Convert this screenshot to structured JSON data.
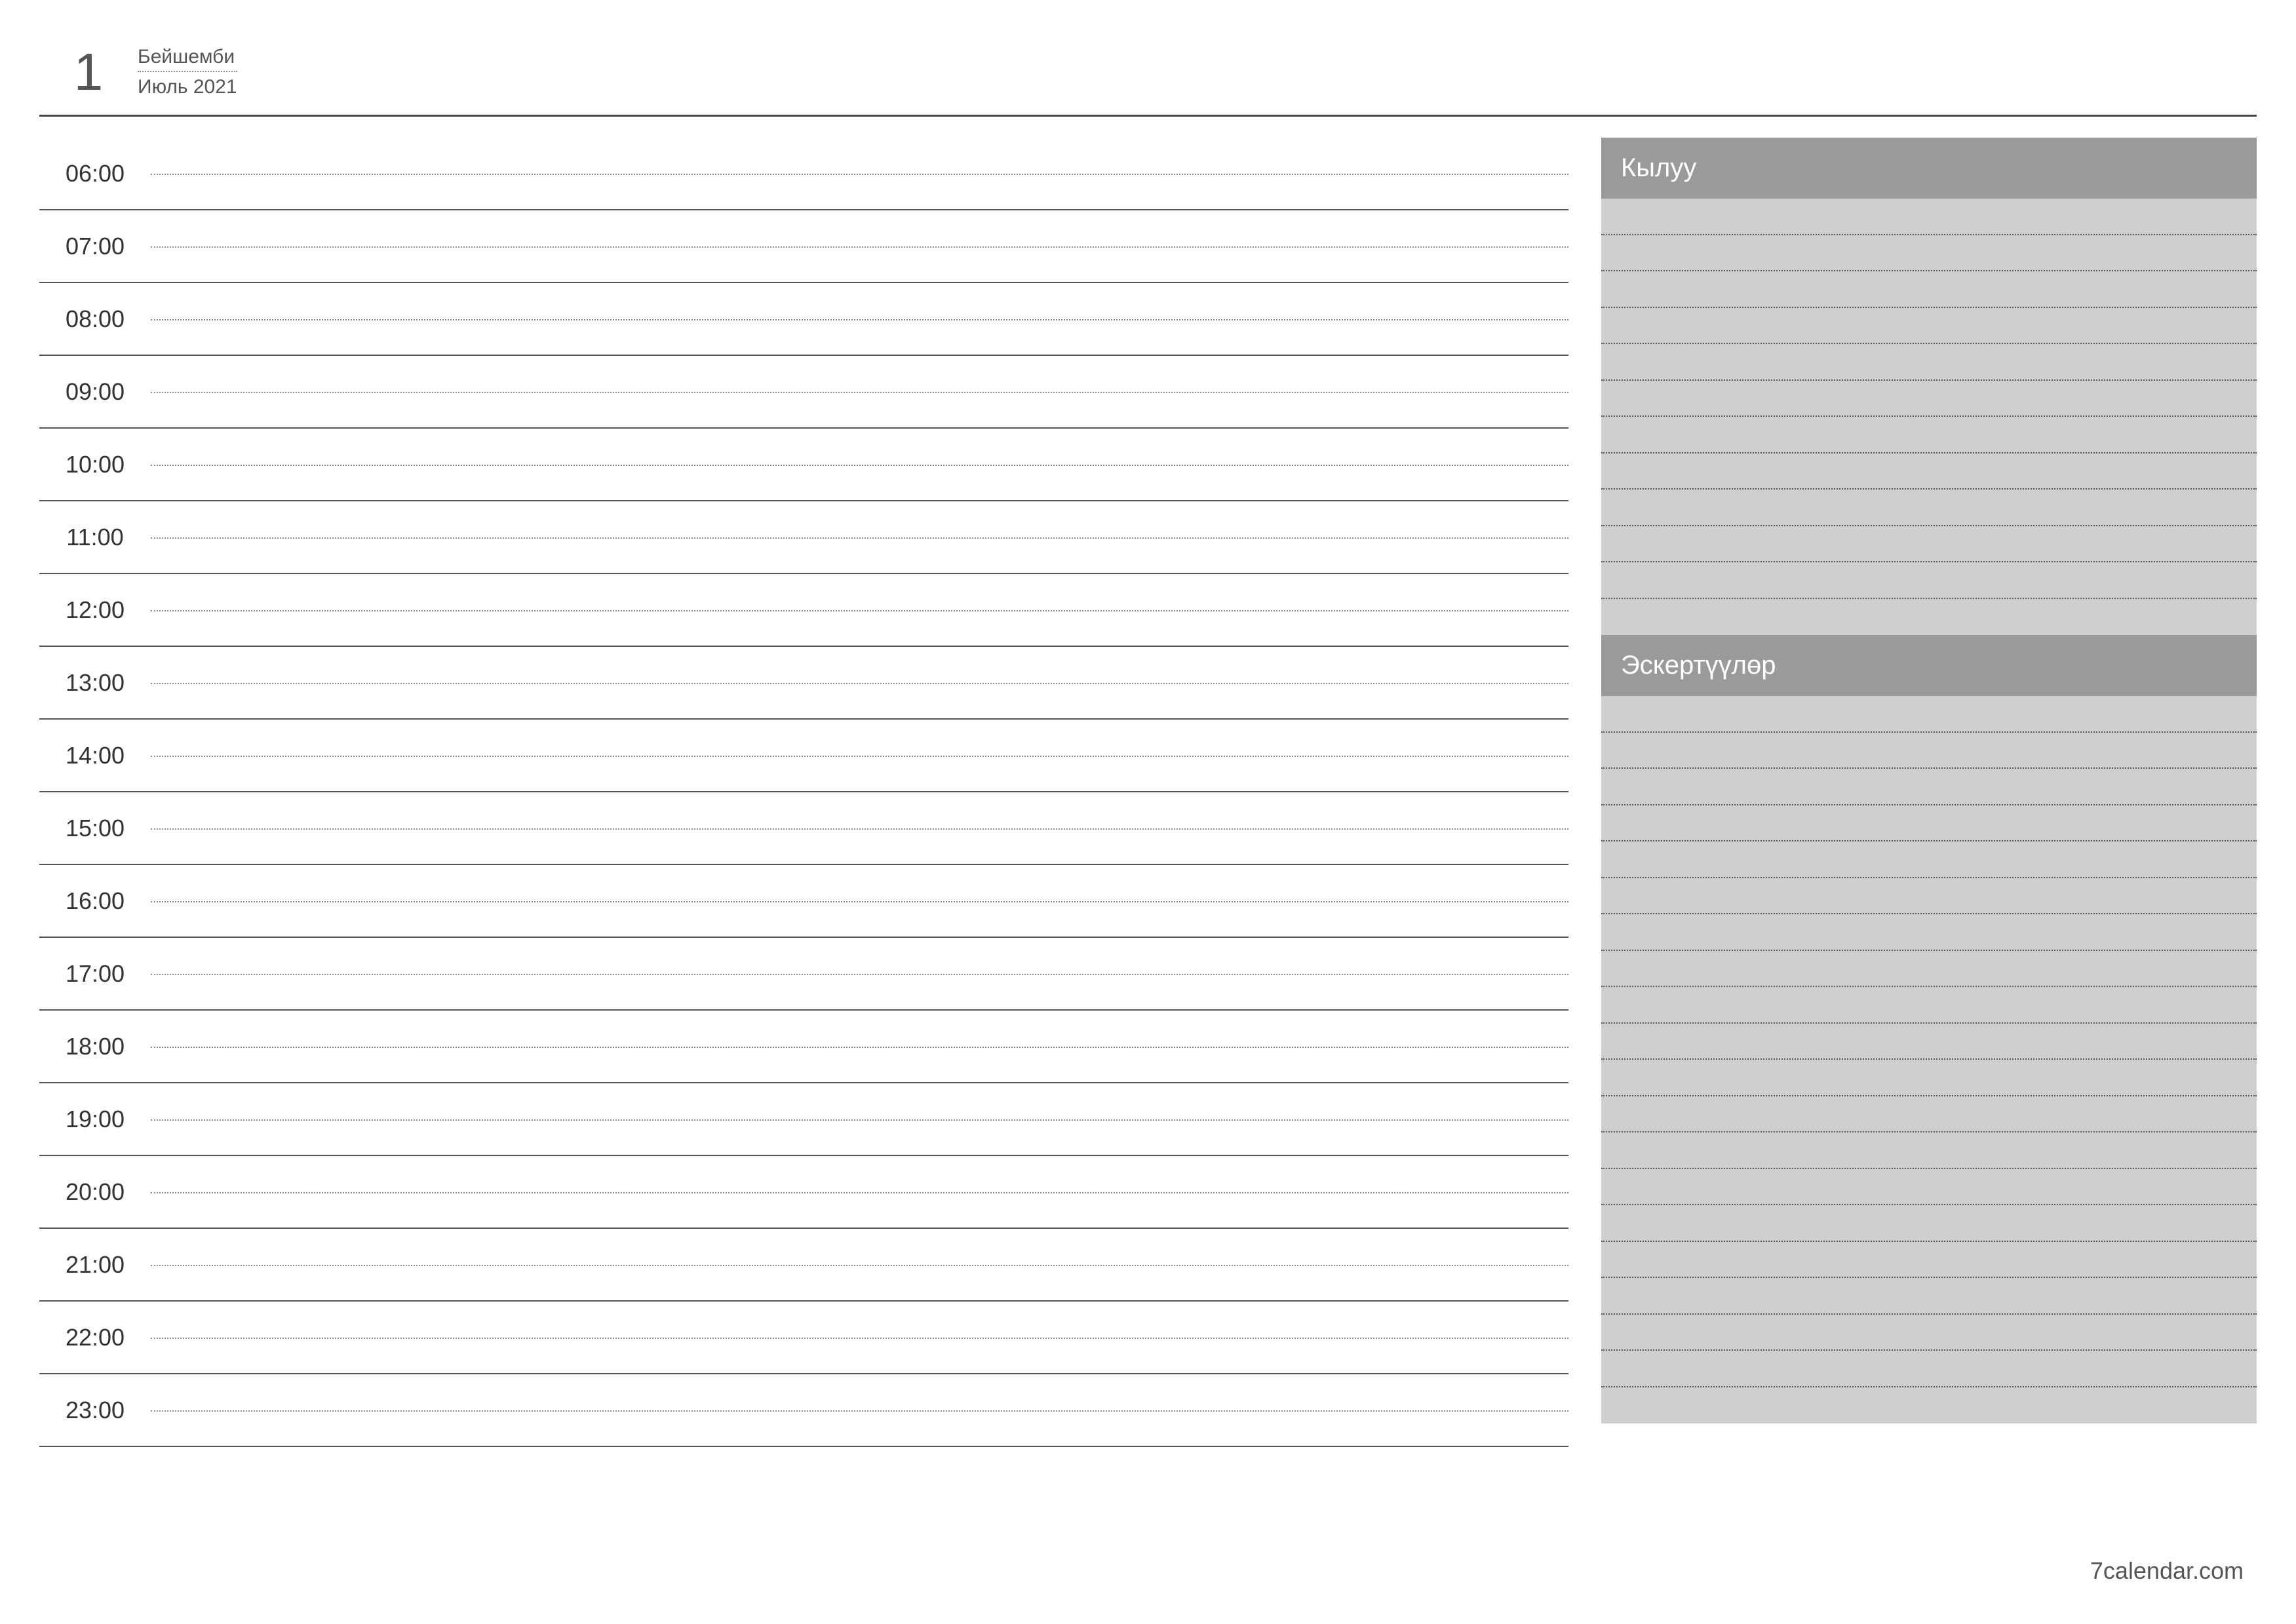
{
  "header": {
    "day_number": "1",
    "day_name": "Бейшемби",
    "month_year": "Июль 2021"
  },
  "schedule": {
    "hours": [
      "06:00",
      "07:00",
      "08:00",
      "09:00",
      "10:00",
      "11:00",
      "12:00",
      "13:00",
      "14:00",
      "15:00",
      "16:00",
      "17:00",
      "18:00",
      "19:00",
      "20:00",
      "21:00",
      "22:00",
      "23:00"
    ]
  },
  "sidebar": {
    "todo_title": "Кылуу",
    "notes_title": "Эскертүүлөр",
    "todo_lines": 12,
    "notes_lines": 20
  },
  "footer": {
    "site": "7calendar.com"
  }
}
